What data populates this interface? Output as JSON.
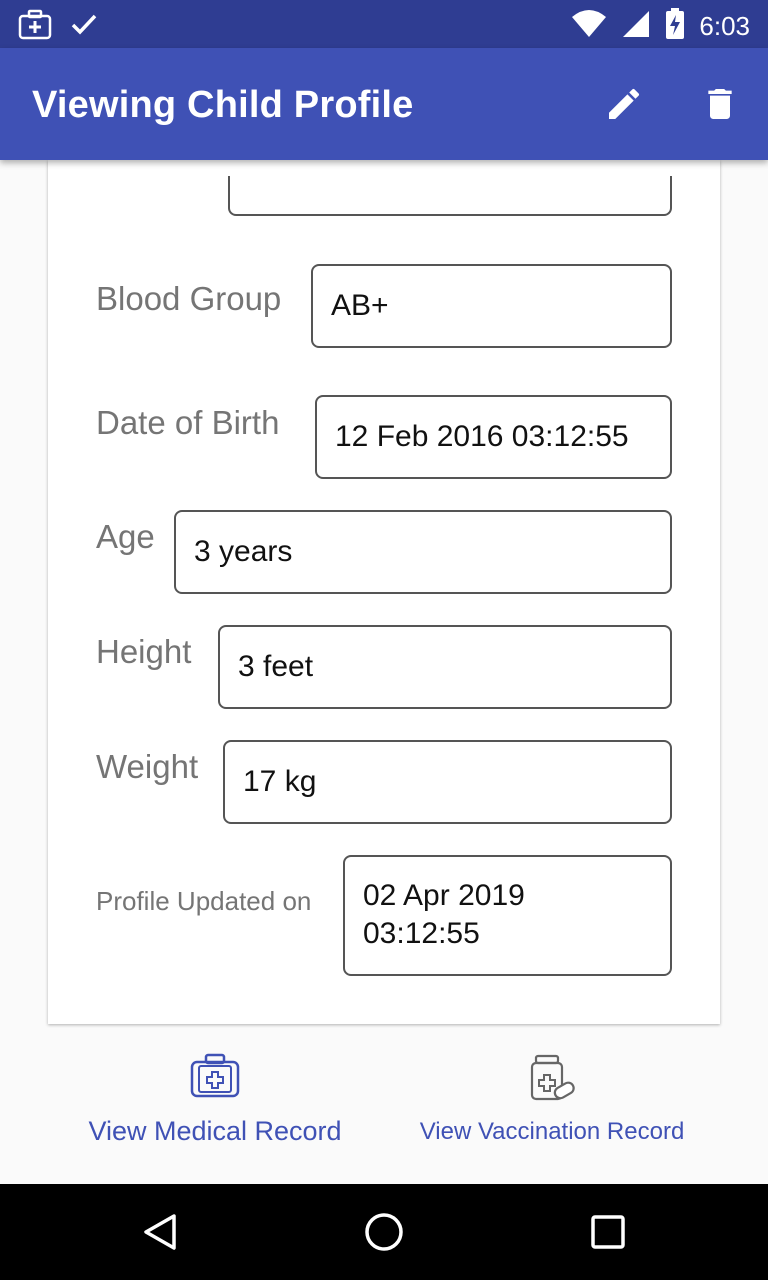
{
  "status_bar": {
    "time": "6:03",
    "icons": [
      "medical-kit-icon",
      "check-icon",
      "wifi-icon",
      "cell-signal-icon",
      "battery-charging-icon"
    ]
  },
  "app_bar": {
    "title": "Viewing Child Profile",
    "actions": [
      "edit-icon",
      "delete-icon"
    ]
  },
  "profile": {
    "fields": [
      {
        "label": "Blood Group",
        "value": "AB+"
      },
      {
        "label": "Date of Birth",
        "value": "12 Feb 2016 03:12:55"
      },
      {
        "label": "Age",
        "value": "3 years"
      },
      {
        "label": "Height",
        "value": "3 feet"
      },
      {
        "label": "Weight",
        "value": "17 kg"
      },
      {
        "label": "Profile Updated on",
        "value": "02 Apr 2019\n03:12:55"
      }
    ]
  },
  "bottom_actions": {
    "medical": {
      "label": "View Medical Record",
      "icon": "medical-kit-icon"
    },
    "vaccination": {
      "label": "View Vaccination Record",
      "icon": "medicine-bottle-icon"
    }
  },
  "nav_bar": {
    "buttons": [
      "back-icon",
      "home-icon",
      "recents-icon"
    ]
  },
  "colors": {
    "primary": "#3f51b5",
    "status_bar": "#2f3d92",
    "label_gray": "#757575"
  }
}
